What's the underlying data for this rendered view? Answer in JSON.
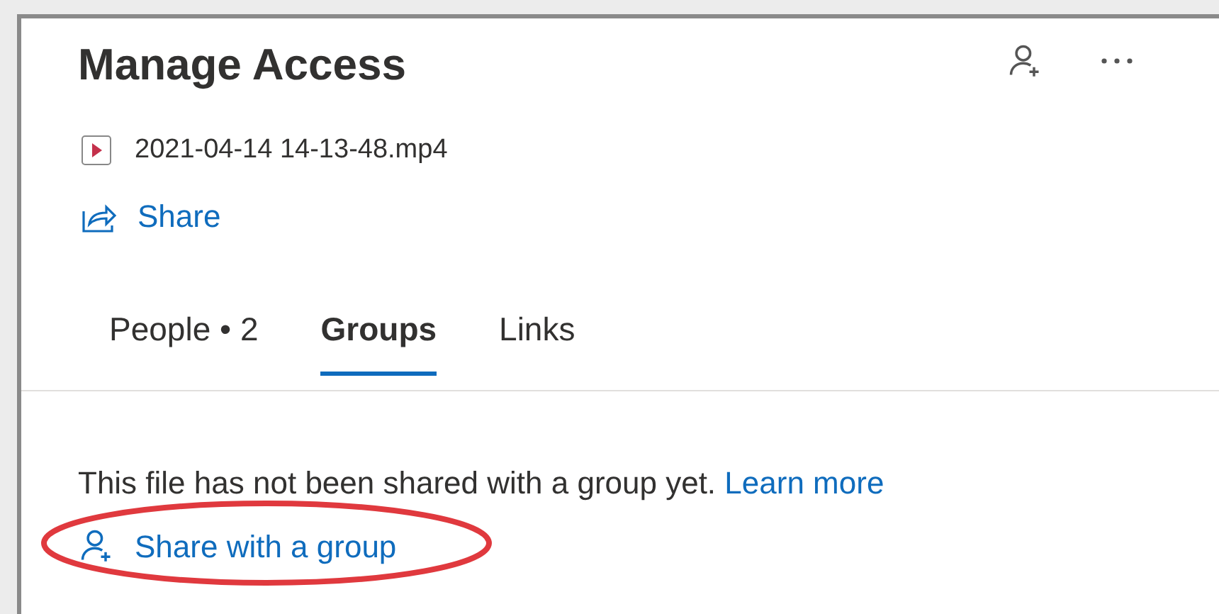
{
  "header": {
    "title": "Manage Access"
  },
  "file": {
    "name": "2021-04-14 14-13-48.mp4"
  },
  "share_link": {
    "label": "Share"
  },
  "tabs": [
    {
      "label": "People • 2",
      "selected": false
    },
    {
      "label": "Groups",
      "selected": true
    },
    {
      "label": "Links",
      "selected": false
    }
  ],
  "message": {
    "text": "This file has not been shared with a group yet.",
    "link": "Learn more"
  },
  "action": {
    "label": "Share with a group",
    "highlighted": true
  }
}
